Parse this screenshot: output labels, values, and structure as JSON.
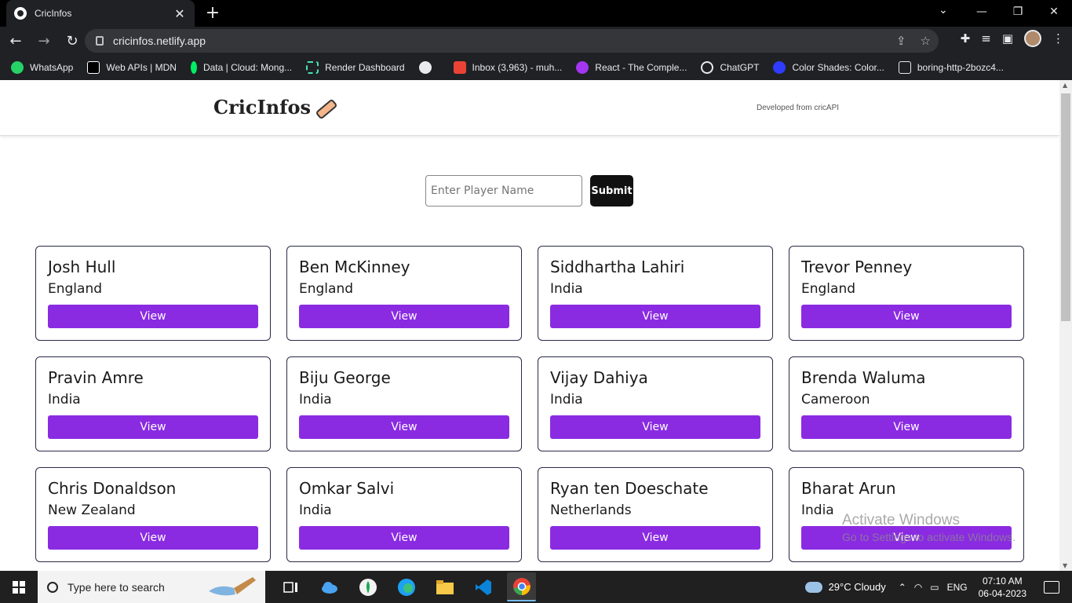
{
  "browser": {
    "tab_title": "CricInfos",
    "url": "cricinfos.netlify.app",
    "bookmarks": [
      {
        "label": "WhatsApp",
        "color": "#25d366"
      },
      {
        "label": "Web APIs | MDN",
        "color": "#ffffff"
      },
      {
        "label": "Data | Cloud: Mong...",
        "color": "#00ed64"
      },
      {
        "label": "Render Dashboard",
        "color": "#46e3b7"
      },
      {
        "label": "",
        "color": "#e8eaed"
      },
      {
        "label": "Inbox (3,963) - muh...",
        "color": "#ea4335"
      },
      {
        "label": "React - The Comple...",
        "color": "#a435f0"
      },
      {
        "label": "ChatGPT",
        "color": "#e8eaed"
      },
      {
        "label": "Color Shades: Color...",
        "color": "#2f3bff"
      },
      {
        "label": "boring-http-2bozc4...",
        "color": "#202124"
      }
    ]
  },
  "site": {
    "logo": "CricInfos",
    "credit": "Developed from cricAPI",
    "search": {
      "placeholder": "Enter Player Name",
      "submit_label": "Submit"
    },
    "view_label": "View",
    "players": [
      {
        "name": "Josh Hull",
        "country": "England"
      },
      {
        "name": "Ben McKinney",
        "country": "England"
      },
      {
        "name": "Siddhartha Lahiri",
        "country": "India"
      },
      {
        "name": "Trevor Penney",
        "country": "England"
      },
      {
        "name": "Pravin Amre",
        "country": "India"
      },
      {
        "name": "Biju George",
        "country": "India"
      },
      {
        "name": "Vijay Dahiya",
        "country": "India"
      },
      {
        "name": "Brenda Waluma",
        "country": "Cameroon"
      },
      {
        "name": "Chris Donaldson",
        "country": "New Zealand"
      },
      {
        "name": "Omkar Salvi",
        "country": "India"
      },
      {
        "name": "Ryan ten Doeschate",
        "country": "Netherlands"
      },
      {
        "name": "Bharat Arun",
        "country": "India"
      }
    ],
    "accent_color": "#8a2be2"
  },
  "watermark": {
    "line1": "Activate Windows",
    "line2": "Go to Settings to activate Windows."
  },
  "taskbar": {
    "search_placeholder": "Type here to search",
    "weather": "29°C  Cloudy",
    "language": "ENG",
    "time": "07:10 AM",
    "date": "06-04-2023"
  }
}
